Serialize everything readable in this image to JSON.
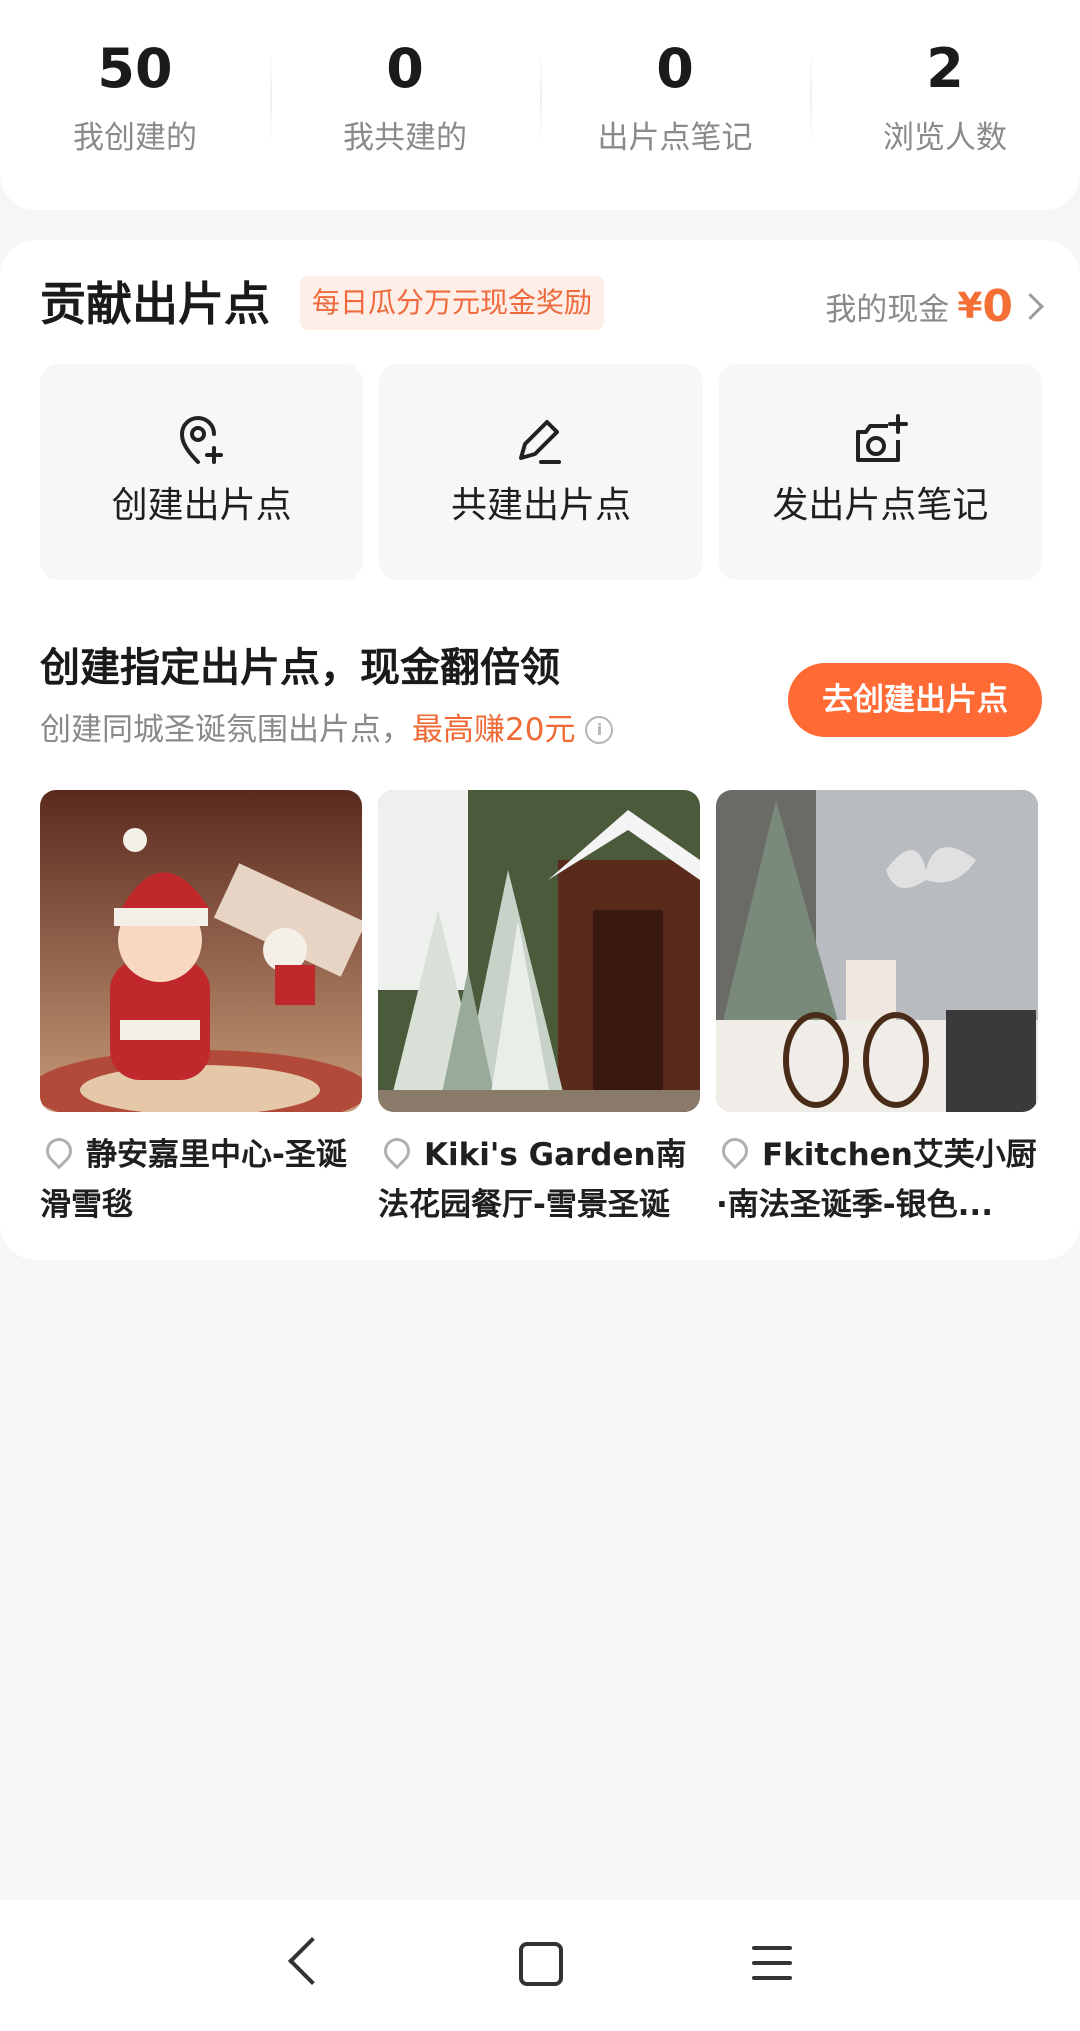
{
  "stats": [
    {
      "value": "50",
      "label": "我创建的"
    },
    {
      "value": "0",
      "label": "我共建的"
    },
    {
      "value": "0",
      "label": "出片点笔记"
    },
    {
      "value": "2",
      "label": "浏览人数"
    }
  ],
  "contribute": {
    "title": "贡献出片点",
    "badge": "每日瓜分万元现金奖励",
    "cash_label": "我的现金",
    "cash_currency": "¥",
    "cash_value": "0"
  },
  "actions": [
    {
      "label": "创建出片点",
      "icon": "location-plus-icon"
    },
    {
      "label": "共建出片点",
      "icon": "edit-pen-icon"
    },
    {
      "label": "发出片点笔记",
      "icon": "camera-plus-icon"
    }
  ],
  "create_section": {
    "title": "创建指定出片点，现金翻倍领",
    "subtitle": "创建同城圣诞氛围出片点，",
    "highlight": "最高赚20元",
    "button": "去创建出片点"
  },
  "places": [
    {
      "name": "静安嘉里中心-圣诞滑雪毯"
    },
    {
      "name": "Kiki's Garden南法花园餐厅-雪景圣诞树"
    },
    {
      "name": "Fkitchen艾芙小厨·南法圣诞季-银色..."
    }
  ],
  "colors": {
    "accent": "#ff6a35",
    "badge_bg": "#fdeee8",
    "page_bg": "#f5f6f8"
  }
}
